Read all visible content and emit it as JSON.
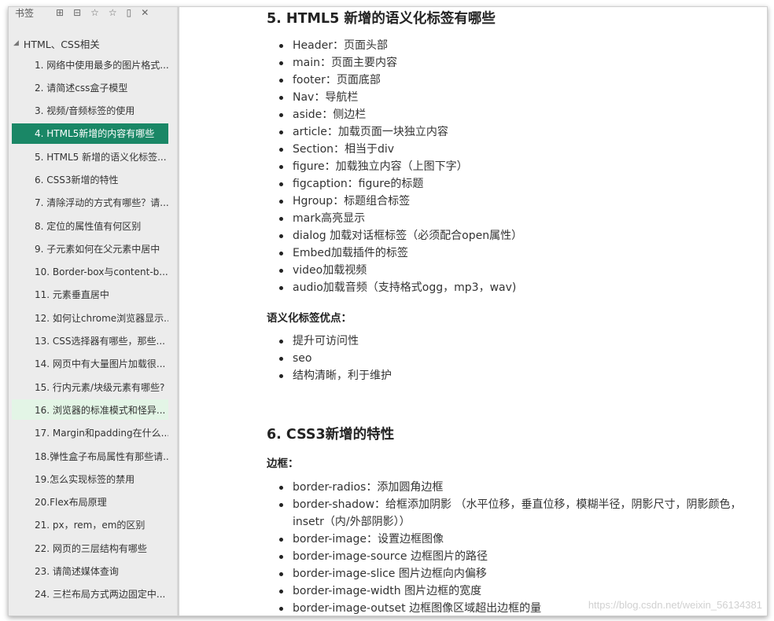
{
  "sidebar": {
    "toolbar_label": "书签",
    "root_label": "HTML、CSS相关",
    "items": [
      "1. 网络中使用最多的图片格式...",
      "2. 请简述css盒子模型",
      "3. 视频/音频标签的使用",
      "4. HTML5新增的内容有哪些",
      "5. HTML5 新增的语义化标签...",
      "6. CSS3新增的特性",
      "7. 清除浮动的方式有哪些？请...",
      "8. 定位的属性值有何区别",
      "9. 子元素如何在父元素中居中",
      "10. Border-box与content-b...",
      "11. 元素垂直居中",
      "12. 如何让chrome浏览器显示...",
      "13. CSS选择器有哪些，那些...",
      "14. 网页中有大量图片加载很...",
      "15. 行内元素/块级元素有哪些?",
      "16. 浏览器的标准模式和怪异...",
      "17. Margin和padding在什么...",
      "18.弹性盒子布局属性有那些请...",
      "19.怎么实现标签的禁用",
      "20.Flex布局原理",
      "21. px，rem，em的区别",
      "22. 网页的三层结构有哪些",
      "23. 请简述媒体查询",
      "24. 三栏布局方式两边固定中..."
    ],
    "active_index": 3,
    "hover_index": 15
  },
  "content": {
    "section5_title": "5. HTML5 新增的语义化标签有哪些",
    "section5_items": [
      "Header：页面头部",
      "main：页面主要内容",
      "footer：页面底部",
      "Nav：导航栏",
      "aside：侧边栏",
      "article：加载页面一块独立内容",
      "Section：相当于div",
      "figure：加载独立内容（上图下字）",
      "figcaption：figure的标题",
      "Hgroup：标题组合标签",
      "mark高亮显示",
      "dialog 加载对话框标签（必须配合open属性）",
      "Embed加载插件的标签",
      "video加载视频",
      "audio加载音频（支持格式ogg，mp3，wav)"
    ],
    "advantages_title": "语义化标签优点：",
    "advantages_items": [
      "提升可访问性",
      "seo",
      "结构清晰，利于维护"
    ],
    "section6_title": "6. CSS3新增的特性",
    "border_title": "边框：",
    "border_items": [
      "border-radios：添加圆角边框",
      "border-shadow：给框添加阴影 （水平位移，垂直位移，模糊半径，阴影尺寸，阴影颜色，insetr（内/外部阴影））",
      "border-image：设置边框图像",
      "border-image-source 边框图片的路径",
      "border-image-slice 图片边框向内偏移",
      "border-image-width 图片边框的宽度",
      "border-image-outset 边框图像区域超出边框的量"
    ],
    "watermark": "https://blog.csdn.net/weixin_56134381"
  },
  "colors": {
    "active_bg": "#1a8766",
    "hover_bg": "#e3f5e6",
    "sidebar_bg": "#ececec"
  },
  "icons": [
    "add-bookmark-icon",
    "remove-bookmark-icon",
    "bookmark-icon",
    "bookmark-outline-icon",
    "document-icon",
    "close-icon"
  ]
}
